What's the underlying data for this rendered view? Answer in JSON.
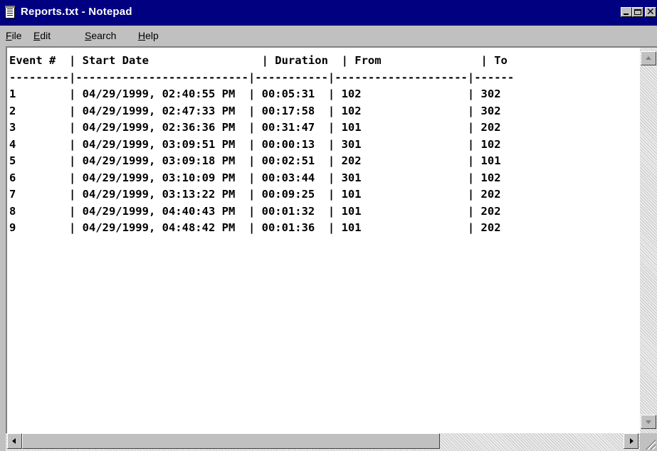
{
  "window": {
    "title": "Reports.txt - Notepad",
    "title_bar_color": "#000080"
  },
  "menu": {
    "file": {
      "accel": "F",
      "rest": "ile"
    },
    "edit": {
      "accel": "E",
      "rest": "dit"
    },
    "search": {
      "accel": "S",
      "rest": "earch"
    },
    "help": {
      "accel": "H",
      "rest": "elp"
    }
  },
  "icons": {
    "app": "notepad-icon",
    "minimize": "minimize-icon",
    "maximize": "maximize-icon",
    "close": "close-icon",
    "scroll_up": "scroll-up-arrow-icon",
    "scroll_down": "scroll-down-arrow-icon",
    "scroll_left": "scroll-left-arrow-icon",
    "scroll_right": "scroll-right-arrow-icon",
    "resize": "resize-grip-icon"
  },
  "document": {
    "content": "Event #  | Start Date                 | Duration  | From               | To\n---------|--------------------------|-----------|--------------------|------\n1        | 04/29/1999, 02:40:55 PM  | 00:05:31  | 102                | 302\n2        | 04/29/1999, 02:47:33 PM  | 00:17:58  | 102                | 302\n3        | 04/29/1999, 02:36:36 PM  | 00:31:47  | 101                | 202\n4        | 04/29/1999, 03:09:51 PM  | 00:00:13  | 301                | 102\n5        | 04/29/1999, 03:09:18 PM  | 00:02:51  | 202                | 101\n6        | 04/29/1999, 03:10:09 PM  | 00:03:44  | 301                | 102\n7        | 04/29/1999, 03:13:22 PM  | 00:09:25  | 101                | 202\n8        | 04/29/1999, 04:40:43 PM  | 00:01:32  | 101                | 202\n9        | 04/29/1999, 04:48:42 PM  | 00:01:36  | 101                | 202"
  }
}
